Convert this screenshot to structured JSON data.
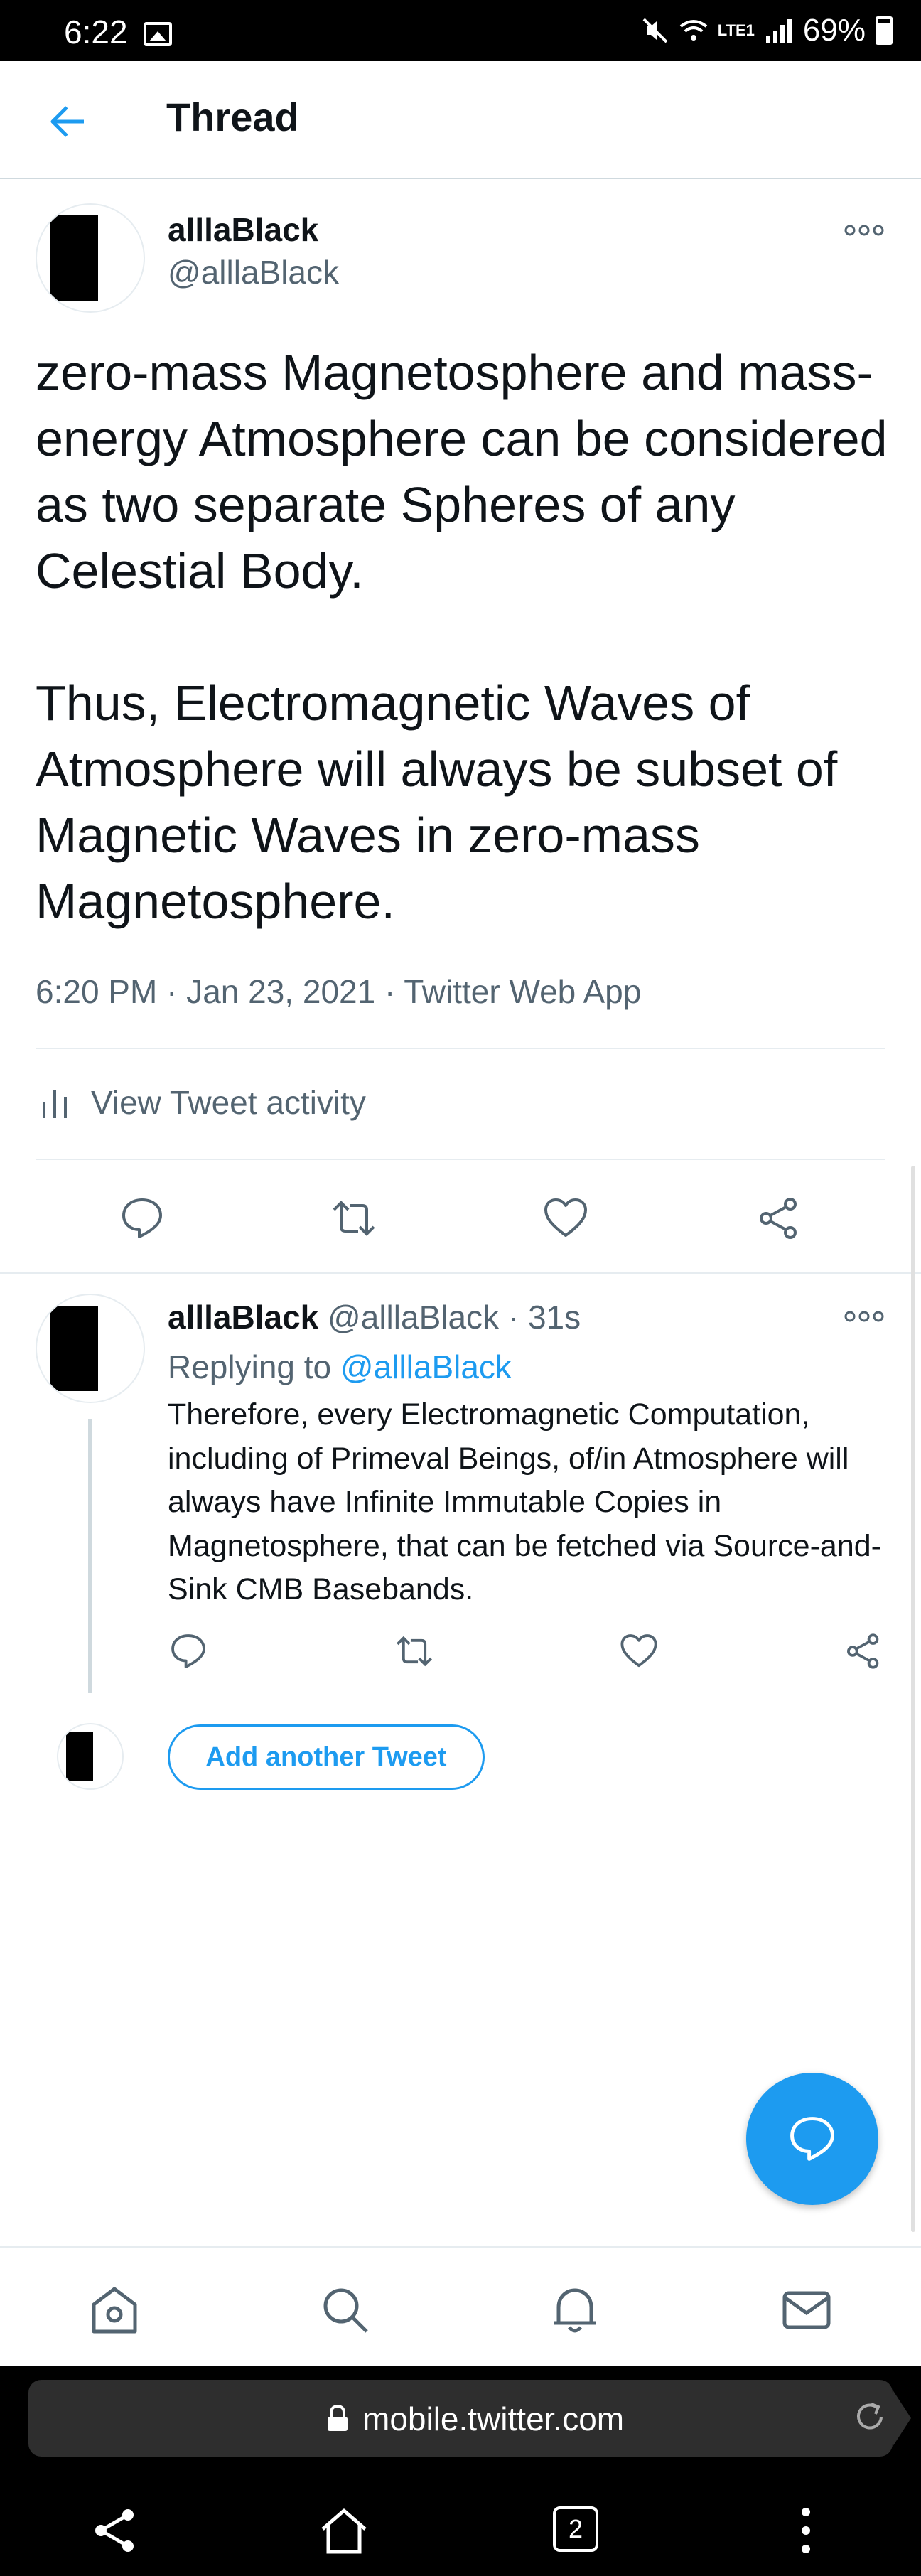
{
  "status_bar": {
    "time": "6:22",
    "battery_percent": "69%",
    "network": "LTE1"
  },
  "header": {
    "title": "Thread"
  },
  "main_tweet": {
    "author_name": "alllaBlack",
    "author_handle": "@alllaBlack",
    "text": "zero-mass Magnetosphere and mass-energy Atmosphere can be considered as two separate Spheres of any Celestial Body.\n\nThus, Electromagnetic Waves of Atmosphere will always be subset of Magnetic Waves in zero-mass Magnetosphere.",
    "timestamp": "6:20 PM · Jan 23, 2021 · Twitter Web App",
    "activity_label": "View Tweet activity"
  },
  "reply": {
    "author_name": "alllaBlack",
    "author_handle": "@alllaBlack",
    "separator": "·",
    "time_ago": "31s",
    "replying_prefix": "Replying to",
    "replying_to": "@alllaBlack",
    "text": "Therefore, every Electromagnetic Computation, including of Primeval Beings, of/in Atmosphere will always have Infinite Immutable Copies in Magnetosphere, that can be fetched via Source-and-Sink CMB Basebands."
  },
  "add_tweet": {
    "label": "Add another Tweet"
  },
  "bottom_nav": {
    "items": [
      "home-icon",
      "search-icon",
      "notifications-icon",
      "messages-icon"
    ]
  },
  "browser": {
    "url": "mobile.twitter.com",
    "tab_count": "2"
  },
  "colors": {
    "accent": "#1d9bf0",
    "secondary_text": "#536471",
    "divider": "#e6ecf0"
  }
}
